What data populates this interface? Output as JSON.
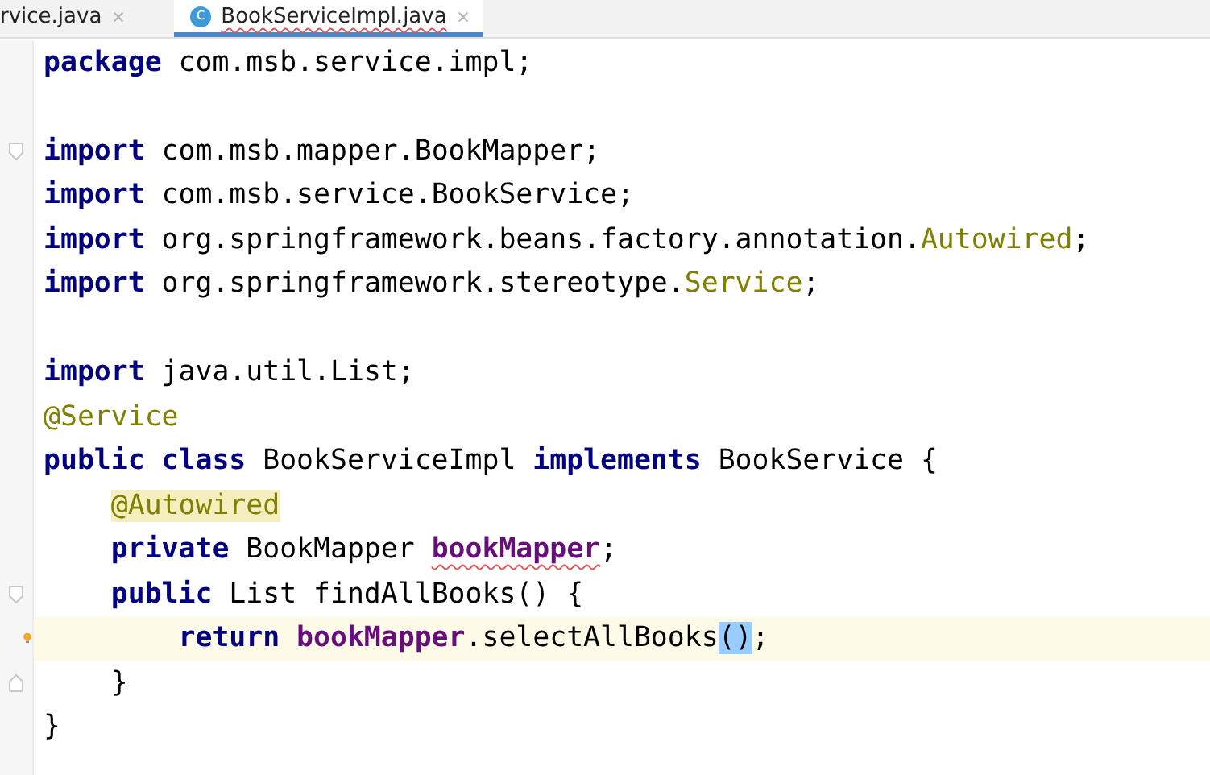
{
  "tabs": [
    {
      "label": "rvice.java",
      "selected": false,
      "typo": false
    },
    {
      "label": "BookServiceImpl.java",
      "selected": true,
      "typo": true,
      "badge": "c"
    }
  ],
  "lines": [
    {
      "kind": "code",
      "tokens": [
        {
          "kind": "kw",
          "text": "package"
        },
        {
          "kind": "plain",
          "text": " com.msb.service.impl;"
        }
      ]
    },
    {
      "kind": "blank"
    },
    {
      "kind": "code",
      "fold_open": true,
      "tokens": [
        {
          "kind": "kw",
          "text": "import"
        },
        {
          "kind": "plain",
          "text": " com.msb.mapper.BookMapper;"
        }
      ]
    },
    {
      "kind": "code",
      "tokens": [
        {
          "kind": "kw",
          "text": "import"
        },
        {
          "kind": "plain",
          "text": " com.msb.service.BookService;"
        }
      ]
    },
    {
      "kind": "code",
      "tokens": [
        {
          "kind": "kw",
          "text": "import"
        },
        {
          "kind": "plain",
          "text": " org.springframework.beans.factory.annotation."
        },
        {
          "kind": "anno",
          "text": "Autowired"
        },
        {
          "kind": "plain",
          "text": ";"
        }
      ]
    },
    {
      "kind": "code",
      "tokens": [
        {
          "kind": "kw",
          "text": "import"
        },
        {
          "kind": "plain",
          "text": " org.springframework.stereotype."
        },
        {
          "kind": "anno",
          "text": "Service"
        },
        {
          "kind": "plain",
          "text": ";"
        }
      ]
    },
    {
      "kind": "blank"
    },
    {
      "kind": "code",
      "tokens": [
        {
          "kind": "kw",
          "text": "import"
        },
        {
          "kind": "plain",
          "text": " java.util.List;"
        }
      ]
    },
    {
      "kind": "code",
      "tokens": [
        {
          "kind": "anno",
          "text": "@Service"
        }
      ]
    },
    {
      "kind": "code",
      "tokens": [
        {
          "kind": "kw",
          "text": "public class"
        },
        {
          "kind": "plain",
          "text": " BookServiceImpl "
        },
        {
          "kind": "kw",
          "text": "implements"
        },
        {
          "kind": "plain",
          "text": " BookService {"
        }
      ],
      "children": [
        {
          "kind": "code",
          "tokens": [
            {
              "kind": "anno-hl",
              "text": "@Autowired"
            }
          ]
        },
        {
          "kind": "code",
          "tokens": [
            {
              "kind": "kw",
              "text": "private"
            },
            {
              "kind": "plain",
              "text": " BookMapper "
            },
            {
              "kind": "field-typo",
              "text": "bookMapper"
            },
            {
              "kind": "plain",
              "text": ";"
            }
          ]
        },
        {
          "kind": "code",
          "fold_open": true,
          "tokens": [
            {
              "kind": "kw",
              "text": "public"
            },
            {
              "kind": "plain",
              "text": " List findAllBooks() {"
            }
          ],
          "children": [
            {
              "kind": "code",
              "current": true,
              "bulb": true,
              "tokens": [
                {
                  "kind": "kw",
                  "text": "return"
                },
                {
                  "kind": "field",
                  "text": "bookMapper"
                },
                {
                  "kind": "plain",
                  "text": ".selectAllBooks"
                },
                {
                  "kind": "match",
                  "text": "()"
                },
                {
                  "kind": "plain",
                  "text": ";"
                }
              ]
            }
          ]
        },
        {
          "kind": "code",
          "fold_close": true,
          "tokens": [
            {
              "kind": "plain",
              "text": "}"
            }
          ]
        }
      ]
    },
    {
      "kind": "code",
      "tokens": [
        {
          "kind": "plain",
          "text": "}"
        }
      ]
    }
  ]
}
